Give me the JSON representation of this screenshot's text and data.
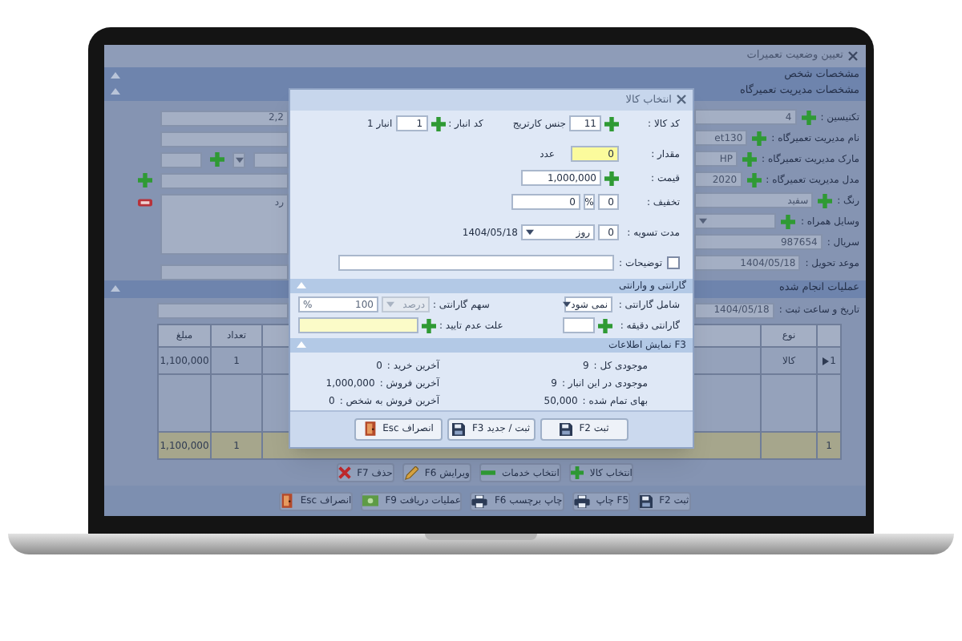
{
  "window": {
    "title": "تعیین وضعیت تعمیرات"
  },
  "sections": [
    {
      "title": "مشخصات شخص"
    },
    {
      "title": "مشخصات مدیریت تعمیرگاه"
    },
    {
      "title": "عملیات انجام شده"
    }
  ],
  "device_fields": [
    {
      "label": "تکنیسین :",
      "value": "4",
      "kind": "text",
      "add": true
    },
    {
      "label": "نام مدیریت تعمیرگاه :",
      "value": "et130",
      "kind": "text",
      "add": true
    },
    {
      "label": "مارک مدیریت تعمیرگاه :",
      "value": "HP",
      "kind": "text",
      "add": true
    },
    {
      "label": "مدل مدیریت تعمیرگاه :",
      "value": "2020",
      "kind": "text",
      "add": true
    },
    {
      "label": "رنگ :",
      "value": "سفید",
      "kind": "text",
      "add": true
    },
    {
      "label": "وسایل همراه :",
      "kind": "dropdown",
      "add": true
    },
    {
      "label": "سریال :",
      "value": "987654",
      "kind": "text",
      "add": false
    },
    {
      "label": "موعد تحویل :",
      "value": "1404/05/18",
      "kind": "text",
      "add": false
    }
  ],
  "side_panel": {
    "field_value": "2,2",
    "notes": "رد"
  },
  "registration": {
    "label": "تاریخ و ساعت ثبت :",
    "value": "1404/05/18"
  },
  "table": {
    "type_column": "نوع",
    "count_column": "تعداد",
    "amount_column": "مبلغ",
    "rows": [
      {
        "number": "1",
        "type": "کالا",
        "count": "1",
        "amount": "1,100,000"
      }
    ],
    "footer": {
      "number": "1",
      "count": "1",
      "amount": "1,100,000"
    }
  },
  "item_buttons": [
    {
      "label": "انتخاب کالا",
      "kind": "plus"
    },
    {
      "label": "انتخاب خدمات",
      "kind": "minus"
    },
    {
      "label": "ویرایش F6",
      "kind": "pencil"
    },
    {
      "label": "حذف F7",
      "kind": "cross"
    }
  ],
  "footer_buttons": [
    {
      "label": "ثبت F2",
      "kind": "save"
    },
    {
      "label": "F5 چاپ",
      "kind": "print"
    },
    {
      "label": "چاپ برچسب F6",
      "kind": "print"
    },
    {
      "label": "عملیات دریافت F9",
      "kind": "money"
    },
    {
      "label": "انصراف Esc",
      "kind": "exit"
    }
  ],
  "dialog": {
    "title": "انتخاب کالا",
    "item_code": {
      "label": "کد کالا :",
      "value": "11",
      "name": "جنس کارتریج"
    },
    "warehouse": {
      "label": "کد انبار :",
      "value": "1",
      "name": "انبار 1"
    },
    "quantity": {
      "label": "مقدار :",
      "value": "0",
      "unit": "عدد"
    },
    "price": {
      "label": "قیمت :",
      "value": "1,000,000"
    },
    "discount": {
      "label": "تخفیف :",
      "percent": "0",
      "percent_sign": "%",
      "amount": "0"
    },
    "settlement": {
      "label": "مدت تسویه :",
      "days": "0",
      "unit": "روز",
      "date": "1404/05/18"
    },
    "notes": {
      "label": "توضیحات :",
      "checked": false
    },
    "warranty": {
      "title": "گارانتی و وارانتی",
      "includes_label": "شامل گارانتی :",
      "includes_value": "نمی شود",
      "share_label": "سهم گارانتی :",
      "share_unit": "درصد",
      "share_value": "100",
      "share_sign": "%",
      "minutes_label": "گارانتی دقیقه :",
      "reason_label": "علت عدم تایید :"
    },
    "info": {
      "title": "F3 نمایش اطلاعات",
      "items": [
        {
          "label": "موجودی کل :",
          "value": "9"
        },
        {
          "label": "آخرین خرید :",
          "value": "0"
        },
        {
          "label": "موجودی در این انبار :",
          "value": "9"
        },
        {
          "label": "آخرین فروش :",
          "value": "1,000,000"
        },
        {
          "label": "بهای تمام شده :",
          "value": "50,000"
        },
        {
          "label": "آخرین فروش به شخص :",
          "value": "0"
        }
      ]
    },
    "buttons": [
      {
        "label": "ثبت F2",
        "kind": "save"
      },
      {
        "label": "ثبت / جدید F3",
        "kind": "save"
      },
      {
        "label": "انصراف Esc",
        "kind": "exit"
      }
    ]
  }
}
